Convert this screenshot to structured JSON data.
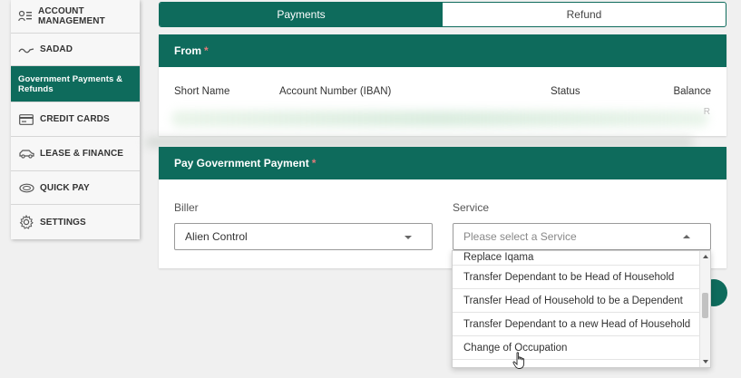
{
  "sidebar": {
    "items": [
      {
        "label": "ACCOUNT MANAGEMENT",
        "icon": "account-management-icon",
        "active": false
      },
      {
        "label": "SADAD",
        "icon": "sadad-logo-icon",
        "active": false
      },
      {
        "label": "Government Payments & Refunds",
        "icon": "",
        "active": true
      },
      {
        "label": "CREDIT CARDS",
        "icon": "credit-card-icon",
        "active": false
      },
      {
        "label": "LEASE & FINANCE",
        "icon": "car-icon",
        "active": false
      },
      {
        "label": "QUICK PAY",
        "icon": "quick-pay-icon",
        "active": false
      },
      {
        "label": "SETTINGS",
        "icon": "gear-icon",
        "active": false
      }
    ]
  },
  "tabs": {
    "payments": "Payments",
    "refund": "Refund"
  },
  "from": {
    "title": "From",
    "required_mark": "*",
    "columns": {
      "short_name": "Short Name",
      "account_number": "Account Number (IBAN)",
      "status": "Status",
      "balance": "Balance"
    },
    "blurred_suffix": "R"
  },
  "pay": {
    "title": "Pay Government Payment",
    "required_mark": "*",
    "biller_label": "Biller",
    "biller_value": "Alien Control",
    "service_label": "Service",
    "service_placeholder": "Please select a Service"
  },
  "service_options": [
    "Replace Iqama",
    "Transfer Dependant to be Head of Household",
    "Transfer Head of Household to be a Dependent",
    "Transfer Dependant to a new Head of Household",
    "Change of Occupation"
  ],
  "colors": {
    "primary": "#0e6b5c",
    "required": "#e07a7a"
  }
}
